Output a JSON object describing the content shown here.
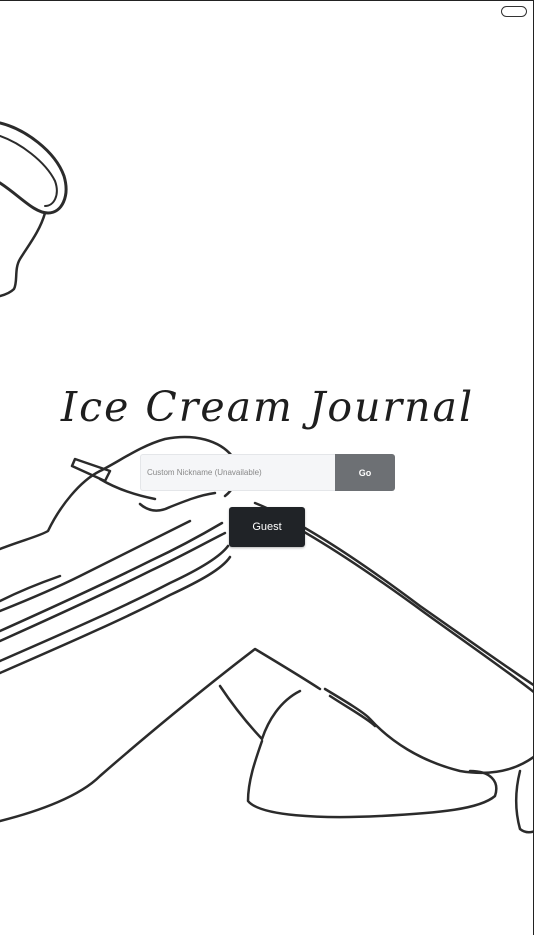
{
  "app": {
    "title": "Ice Cream Journal"
  },
  "login": {
    "nickname_placeholder": "Custom Nickname (Unavailable)",
    "nickname_value": "",
    "go_label": "Go",
    "guest_label": "Guest"
  },
  "background": {
    "art_icon": "line-art-figure-illustration"
  },
  "colors": {
    "go_button": "#6d7074",
    "guest_button": "#202327",
    "input_background": "#f5f6f8",
    "line_art": "#2b2b2b"
  }
}
